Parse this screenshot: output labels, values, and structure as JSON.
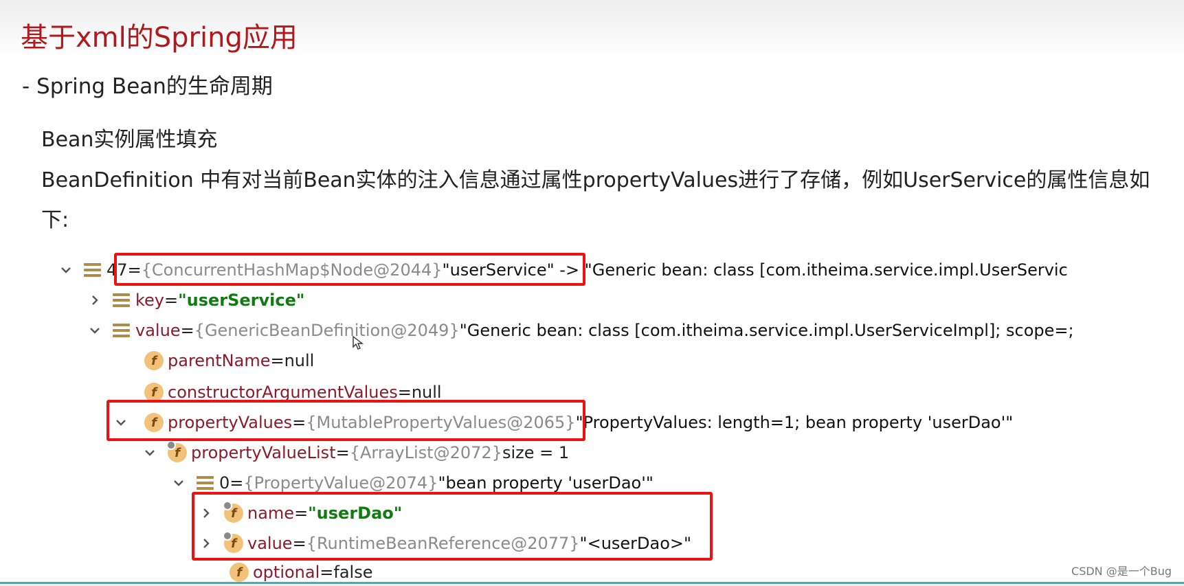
{
  "title": "基于xml的Spring应用",
  "subtitle": "- Spring Bean的生命周期",
  "heading": "Bean实例属性填充",
  "paragraph": "BeanDefinition 中有对当前Bean实体的注入信息通过属性propertyValues进行了存储，例如UserService的属性信息如下:",
  "tree": {
    "row1": {
      "name": "47",
      "eq": " = ",
      "type": "{ConcurrentHashMap$Node@2044}",
      "value": " \"userService\" -> \"Generic bean: class [com.itheima.service.impl.UserServic"
    },
    "row2": {
      "name": "key",
      "eq": " = ",
      "value": "\"userService\""
    },
    "row3": {
      "name": "value",
      "eq": " = ",
      "type": "{GenericBeanDefinition@2049}",
      "value": " \"Generic bean: class [com.itheima.service.impl.UserServiceImpl]; scope=;"
    },
    "row4": {
      "name": "parentName",
      "eq": " = ",
      "value": "null"
    },
    "row5": {
      "name": "constructorArgumentValues",
      "eq": " = ",
      "value": "null"
    },
    "row6": {
      "name": "propertyValues",
      "eq": " = ",
      "type": "{MutablePropertyValues@2065}",
      "value": "\"PropertyValues: length=1; bean property 'userDao'\""
    },
    "row7": {
      "name": "propertyValueList",
      "eq": " = ",
      "type": "{ArrayList@2072}",
      "value": "  size = 1"
    },
    "row8": {
      "name": "0",
      "eq": " = ",
      "type": "{PropertyValue@2074}",
      "value": " \"bean property 'userDao'\""
    },
    "row9": {
      "name": "name",
      "eq": " = ",
      "value": "\"userDao\""
    },
    "row10": {
      "name": "value",
      "eq": " = ",
      "type": "{RuntimeBeanReference@2077}",
      "value": " \"<userDao>\""
    },
    "row11": {
      "name": "optional",
      "eq": " = ",
      "value": "false"
    }
  },
  "icons": {
    "field_letter": "f"
  },
  "watermark": "CSDN @是一个Bug",
  "colors": {
    "title": "#b0181c",
    "highlight_box": "#e11111",
    "field_name": "#8b1a2b",
    "string_green": "#137a13"
  }
}
